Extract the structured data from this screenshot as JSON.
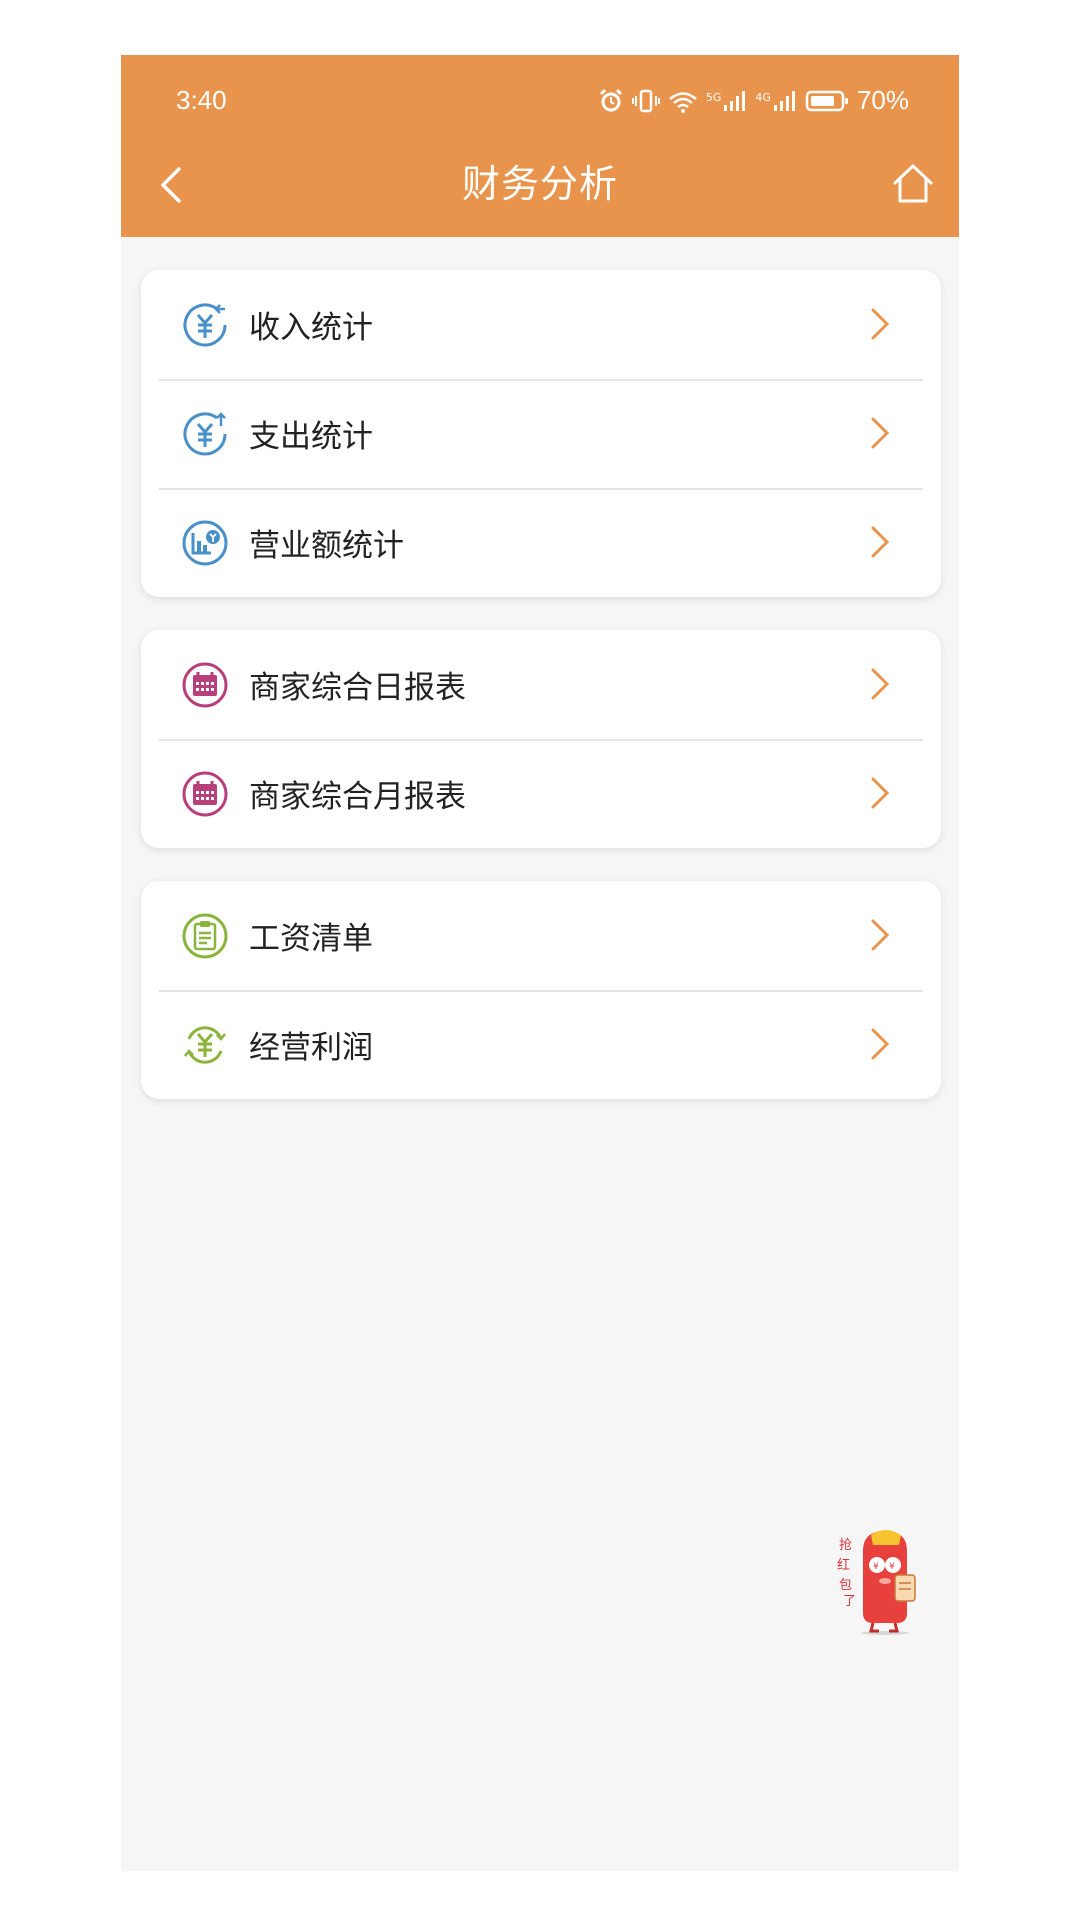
{
  "status_bar": {
    "time": "3:40",
    "network_5g": "5G",
    "network_4g": "4G",
    "battery": "70%"
  },
  "header": {
    "title": "财务分析"
  },
  "groups": [
    {
      "items": [
        {
          "label": "收入统计",
          "icon": "yuan-income-icon"
        },
        {
          "label": "支出统计",
          "icon": "yuan-expense-icon"
        },
        {
          "label": "营业额统计",
          "icon": "revenue-chart-icon"
        }
      ]
    },
    {
      "items": [
        {
          "label": "商家综合日报表",
          "icon": "calendar-icon"
        },
        {
          "label": "商家综合月报表",
          "icon": "calendar-icon"
        }
      ]
    },
    {
      "items": [
        {
          "label": "工资清单",
          "icon": "clipboard-icon"
        },
        {
          "label": "经营利润",
          "icon": "yuan-cycle-icon"
        }
      ]
    }
  ],
  "floating": {
    "mascot_text": "抢红包了",
    "icon": "red-envelope-mascot-icon"
  },
  "colors": {
    "header": "#e8944c",
    "blue_icon": "#4a90c8",
    "pink_icon": "#b8407a",
    "green_icon": "#8ab43c",
    "chevron": "#e8944c"
  }
}
